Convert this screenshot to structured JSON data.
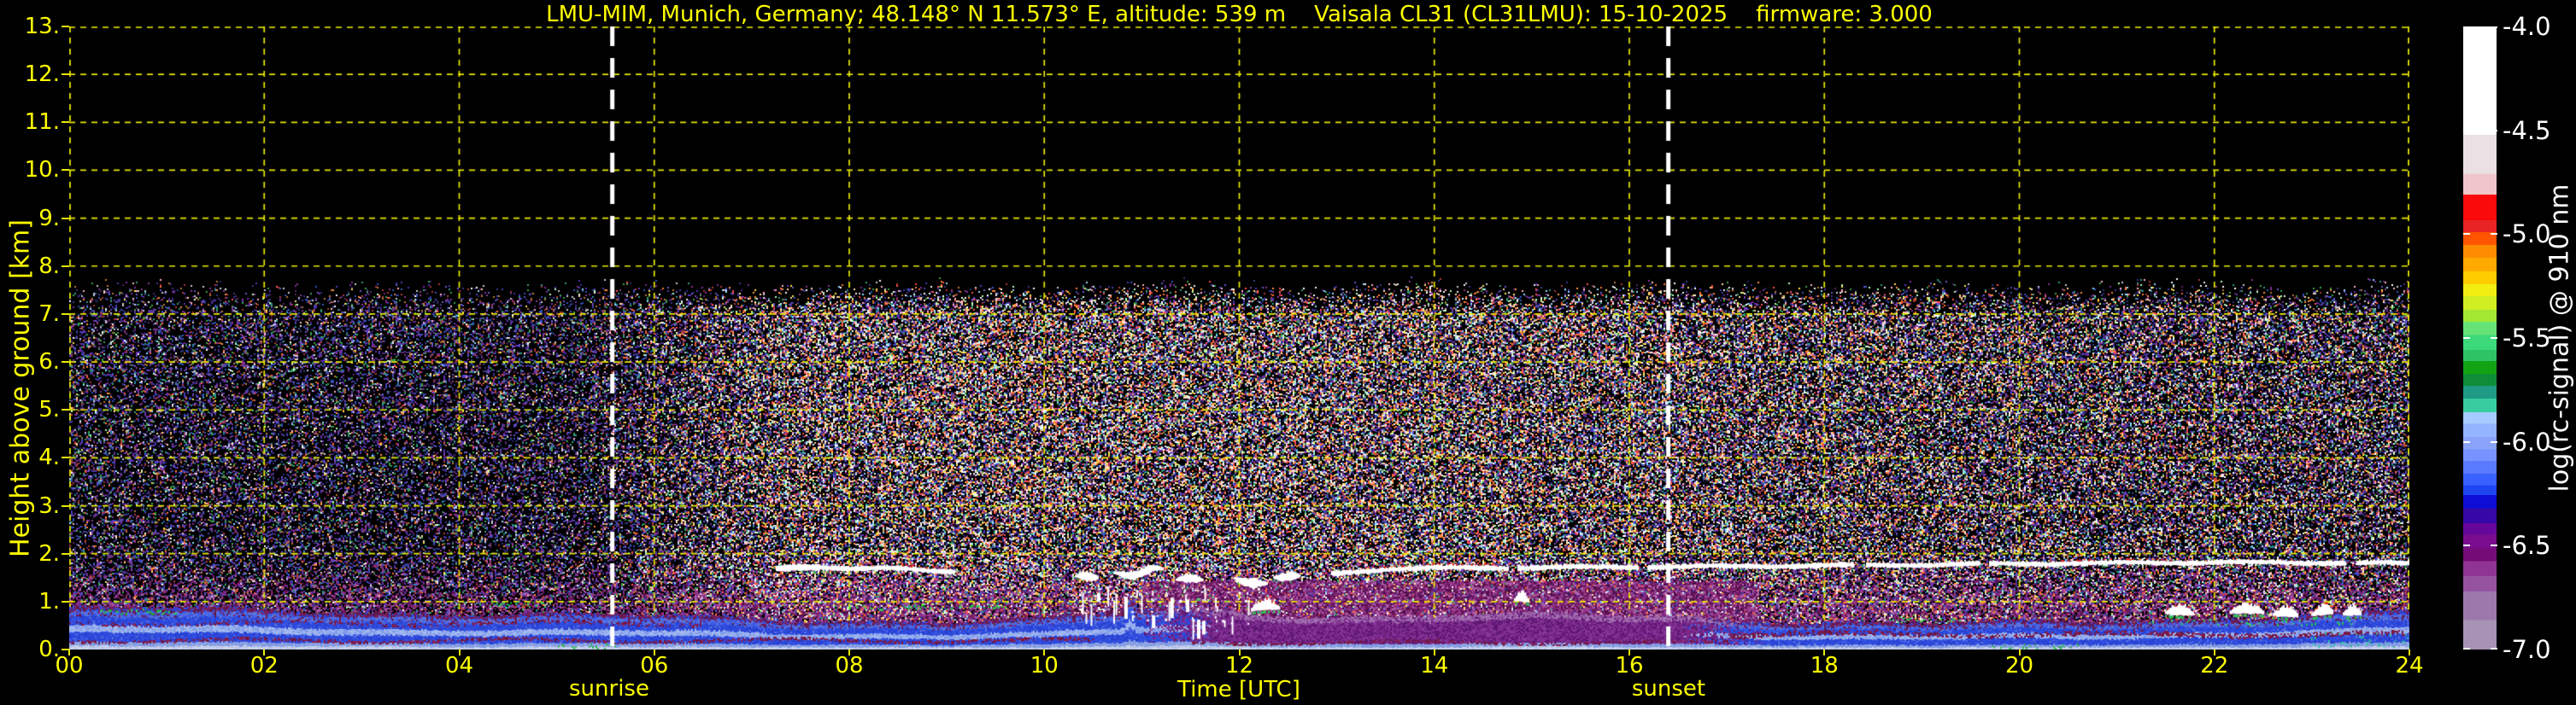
{
  "title": {
    "text": "LMU-MIM, Munich, Germany; 48.148° N 11.573° E, altitude: 539 m    Vaisala CL31 (CL31LMU): 15-10-2025    firmware: 3.000"
  },
  "colors": {
    "background": "#000000",
    "axis_text": "#ffff00",
    "grid": "#e8e800",
    "sun_line": "#ffffff",
    "colorbar_text": "#ffffff"
  },
  "y_axis": {
    "label": "Height above ground [km]",
    "min_km": 0,
    "max_km": 13,
    "tick_labels": [
      "13.",
      "12.",
      "11.",
      "10.",
      "9.",
      "8.",
      "7.",
      "6.",
      "5.",
      "4.",
      "3.",
      "2.",
      "1.",
      "0."
    ]
  },
  "x_axis": {
    "label": "Time [UTC]",
    "min_h": 0,
    "max_h": 24,
    "tick_labels": [
      "00",
      "02",
      "04",
      "06",
      "08",
      "10",
      "12",
      "14",
      "16",
      "18",
      "20",
      "22",
      "24"
    ]
  },
  "sun": {
    "sunrise_label": "sunrise",
    "sunrise_utc": 5.57,
    "sunset_label": "sunset",
    "sunset_utc": 16.4
  },
  "colorbar": {
    "label": "log(rc-signal) @ 910 nm",
    "tick_labels": [
      "-4.0",
      "-4.5",
      "-5.0",
      "-5.5",
      "-6.0",
      "-6.5",
      "-7.0"
    ],
    "value_top": -4.0,
    "value_bottom": -7.0,
    "bands": [
      [
        0.0,
        0.174,
        "#ffffff"
      ],
      [
        0.174,
        0.236,
        "#ebe0e3"
      ],
      [
        0.236,
        0.27,
        "#f0c6ca"
      ],
      [
        0.27,
        0.311,
        "#fa0a0a"
      ],
      [
        0.311,
        0.33,
        "#e82424"
      ],
      [
        0.33,
        0.351,
        "#ff5400"
      ],
      [
        0.351,
        0.371,
        "#ff8c00"
      ],
      [
        0.371,
        0.393,
        "#ffaa00"
      ],
      [
        0.393,
        0.414,
        "#ffcc00"
      ],
      [
        0.414,
        0.433,
        "#f2ee12"
      ],
      [
        0.433,
        0.455,
        "#d0ee22"
      ],
      [
        0.455,
        0.474,
        "#a4e833"
      ],
      [
        0.474,
        0.495,
        "#66e377"
      ],
      [
        0.495,
        0.519,
        "#3cd97a"
      ],
      [
        0.519,
        0.537,
        "#2ec464"
      ],
      [
        0.537,
        0.558,
        "#12a315"
      ],
      [
        0.558,
        0.577,
        "#0e8c38"
      ],
      [
        0.577,
        0.597,
        "#1e9a85"
      ],
      [
        0.597,
        0.619,
        "#37cda0"
      ],
      [
        0.619,
        0.638,
        "#a6ccff"
      ],
      [
        0.638,
        0.659,
        "#94b4ff"
      ],
      [
        0.659,
        0.679,
        "#8aa4fc"
      ],
      [
        0.679,
        0.697,
        "#7793ff"
      ],
      [
        0.697,
        0.718,
        "#5a7aff"
      ],
      [
        0.718,
        0.736,
        "#3a61ff"
      ],
      [
        0.736,
        0.752,
        "#1e45f0"
      ],
      [
        0.752,
        0.773,
        "#0d0dd6"
      ],
      [
        0.773,
        0.797,
        "#3608a8"
      ],
      [
        0.797,
        0.816,
        "#66079b"
      ],
      [
        0.816,
        0.838,
        "#7a0d8e"
      ],
      [
        0.838,
        0.858,
        "#740b77"
      ],
      [
        0.858,
        0.882,
        "#8f3494"
      ],
      [
        0.882,
        0.907,
        "#96539f"
      ],
      [
        0.907,
        0.953,
        "#9b79ab"
      ],
      [
        0.953,
        1.0,
        "#a793b3"
      ]
    ]
  },
  "chart_data": {
    "type": "heatmap",
    "title": "LMU-MIM, Munich, Germany; 48.148° N 11.573° E, altitude: 539 m    Vaisala CL31 (CL31LMU): 15-10-2025    firmware: 3.000",
    "xlabel": "Time [UTC]",
    "ylabel": "Height above ground [km]",
    "x_range_h": [
      0,
      24
    ],
    "y_range_km": [
      0,
      13
    ],
    "value_label": "log(rc-signal) @ 910 nm",
    "value_range": [
      -7.0,
      -4.0
    ],
    "grid": true,
    "legend_position": "right-colorbar",
    "sun_lines": {
      "sunrise_utc": 5.57,
      "sunset_utc": 16.4
    },
    "noise": {
      "top_km": 7.72,
      "night_density": 0.38,
      "day_density": 0.62,
      "night_palette": [
        "#4a3fb0",
        "#5a35bd",
        "#7a2da0",
        "#8a3a90",
        "#6658cc",
        "#45308f",
        "#3156c2",
        "#2f9a8e",
        "#3aa04a",
        "#b03a3a",
        "#b87634",
        "#c9c9d9",
        "#323b90",
        "#5a2470",
        "#2a2a70"
      ],
      "day_palette": [
        "#ffffff",
        "#f4f4f4",
        "#ffd9a0",
        "#ff9040",
        "#ff5050",
        "#ffb0c8",
        "#90dcff",
        "#b8ffb8",
        "#ffe455",
        "#ff7730"
      ],
      "haze_palette": [
        "#7a1a68",
        "#8e2f80",
        "#a34b97",
        "#5c1050",
        "#b06ab0",
        "#6b1b5e",
        "#93358a",
        "#4a0d46"
      ],
      "haze_top_km": 2.05
    },
    "boundary_layer": {
      "top_km": [
        [
          0,
          0.88
        ],
        [
          1,
          0.85
        ],
        [
          2,
          0.82
        ],
        [
          3,
          0.78
        ],
        [
          4,
          0.75
        ],
        [
          5,
          0.72
        ],
        [
          6,
          0.69
        ],
        [
          7,
          0.64
        ],
        [
          8,
          0.61
        ],
        [
          9,
          0.58
        ],
        [
          10,
          0.62
        ],
        [
          10.8,
          0.78
        ],
        [
          11.4,
          0.92
        ],
        [
          12,
          0.78
        ],
        [
          12.6,
          0.7
        ],
        [
          13.5,
          0.68
        ],
        [
          14.5,
          0.7
        ],
        [
          15.5,
          0.72
        ],
        [
          16.5,
          0.7
        ],
        [
          17.2,
          0.62
        ],
        [
          18,
          0.56
        ],
        [
          19,
          0.52
        ],
        [
          20,
          0.55
        ],
        [
          21,
          0.6
        ],
        [
          22,
          0.66
        ],
        [
          23,
          0.72
        ],
        [
          24,
          0.8
        ]
      ],
      "purple_period": [
        11.4,
        16.9
      ],
      "plume_period": [
        10.25,
        12.35
      ]
    },
    "bl_colors": {
      "base": [
        "#c3cde9",
        "#b6c2e4",
        "#cdd5ee"
      ],
      "low": [
        "#8fa6e6",
        "#7f98e0"
      ],
      "mid": [
        "#2e49dd",
        "#3350e2",
        "#2840d0"
      ],
      "upper": [
        "#4a66e8",
        "#5d76d8",
        "#3c58e0"
      ],
      "light_band": [
        "#93adee",
        "#a4baf0",
        "#7f9ae8"
      ],
      "cap": [
        "#6e1b55",
        "#7a2468",
        "#5e1747"
      ],
      "purple_body": [
        "#6f2080",
        "#7b2a8a",
        "#5c1670",
        "#863598"
      ],
      "purple_cap": [
        "#9a61a8",
        "#a875b2",
        "#8d4f9c"
      ],
      "maroon": [
        "#7c1a48",
        "#6e1540",
        "#8a2150"
      ],
      "streaks": [
        {
          "t0": 0,
          "t1": 10.5,
          "km": 0.2,
          "thk": 0.035,
          "p": 0.6
        },
        {
          "t0": 17,
          "t1": 24,
          "km": 0.33,
          "thk": 0.05,
          "p": 0.5
        },
        {
          "t0": 0,
          "t1": 6.5,
          "km": 0.56,
          "thk": 0.04,
          "p": 0.35
        },
        {
          "t0": 11.5,
          "t1": 17,
          "km": 0.16,
          "thk": 0.03,
          "p": 0.5
        }
      ]
    },
    "cloud_layers": {
      "morning_line": {
        "t0": 7.25,
        "t1": 9.08,
        "profile": [
          [
            7.25,
            1.7
          ],
          [
            8.3,
            1.7
          ],
          [
            9.08,
            1.63
          ]
        ],
        "red_after": 8.5
      },
      "midday_blobs": [
        [
          10.32,
          10.55,
          1.52,
          0
        ],
        [
          10.72,
          11.22,
          1.62,
          1
        ],
        [
          11.35,
          11.62,
          1.47,
          0
        ],
        [
          11.95,
          12.28,
          1.43,
          1
        ],
        [
          12.35,
          12.62,
          1.52,
          0
        ]
      ],
      "afternoon_line": {
        "t0": 12.95,
        "t1": 24,
        "profile": [
          [
            12.95,
            1.58
          ],
          [
            13.5,
            1.68
          ],
          [
            14,
            1.7
          ],
          [
            16,
            1.72
          ],
          [
            18,
            1.75
          ],
          [
            20,
            1.79
          ],
          [
            22,
            1.82
          ],
          [
            24,
            1.8
          ]
        ],
        "gaps": [
          [
            14.75,
            14.85
          ],
          [
            16.08,
            16.18
          ],
          [
            18.3,
            18.42
          ],
          [
            19.6,
            19.68
          ],
          [
            23.35,
            23.44
          ]
        ],
        "red_ranges": [
          [
            13.0,
            14.6
          ],
          [
            20.3,
            21.6
          ]
        ]
      },
      "fragment_window": {
        "t0": 10.35,
        "t1": 12.2,
        "km0": 0.55,
        "km1": 1.35,
        "streaks": 26,
        "dots": 60
      },
      "cumulus": [
        [
          21.5,
          21.78,
          0.74
        ],
        [
          22.16,
          22.5,
          0.72
        ],
        [
          22.6,
          22.86,
          0.7
        ],
        [
          23.0,
          23.22,
          0.72
        ],
        [
          23.32,
          23.5,
          0.68
        ],
        [
          12.12,
          12.4,
          0.8
        ],
        [
          14.82,
          14.96,
          1.0
        ]
      ]
    },
    "green_accents": [
      {
        "t0": 0.25,
        "t1": 1.15,
        "km": 0.8,
        "thk": 0.05,
        "p": 0.55,
        "c": [
          "#28c94e",
          "#3bd463",
          "#1fae3f"
        ]
      },
      {
        "t0": 4.3,
        "t1": 5.0,
        "km": 0.95,
        "thk": 0.06,
        "p": 0.6,
        "c": [
          "#28c94e",
          "#3bd463"
        ]
      },
      {
        "t0": 5.0,
        "t1": 5.6,
        "km": 0.08,
        "thk": 0.05,
        "p": 0.4,
        "c": [
          "#2cc24e",
          "#29b548"
        ]
      },
      {
        "t0": 8.0,
        "t1": 9.6,
        "km": 0.9,
        "thk": 0.05,
        "p": 0.45,
        "c": [
          "#28c94e",
          "#33cc55"
        ]
      },
      {
        "t0": 11.1,
        "t1": 12.0,
        "km": 1.15,
        "thk": 0.22,
        "p": 0.18,
        "c": [
          "#2cc24e",
          "#44dd66"
        ]
      },
      {
        "t0": 18.6,
        "t1": 19.4,
        "km": 0.62,
        "thk": 0.04,
        "p": 0.45,
        "c": [
          "#28c94e",
          "#3bd463"
        ]
      },
      {
        "t0": 19.7,
        "t1": 20.6,
        "km": 0.08,
        "thk": 0.05,
        "p": 0.3,
        "c": [
          "#2cc24e",
          "#26a846"
        ]
      },
      {
        "t0": 21.3,
        "t1": 23.4,
        "km": 0.58,
        "thk": 0.06,
        "p": 0.35,
        "c": [
          "#28c94e",
          "#3bd463"
        ]
      },
      {
        "t0": 23.0,
        "t1": 24.0,
        "km": 0.22,
        "thk": 0.16,
        "p": 0.6,
        "c": [
          "#2fd0a0",
          "#38c9ad",
          "#2cbd8e"
        ]
      }
    ],
    "red_accents": [
      {
        "t0": 4.58,
        "t1": 4.68,
        "km": 0.93,
        "p": 0.6
      },
      {
        "t0": 22.3,
        "t1": 23.2,
        "km": 0.74,
        "p": 0.18
      },
      {
        "t0": 11.5,
        "t1": 11.95,
        "km": 0.92,
        "p": 0.15
      }
    ]
  }
}
